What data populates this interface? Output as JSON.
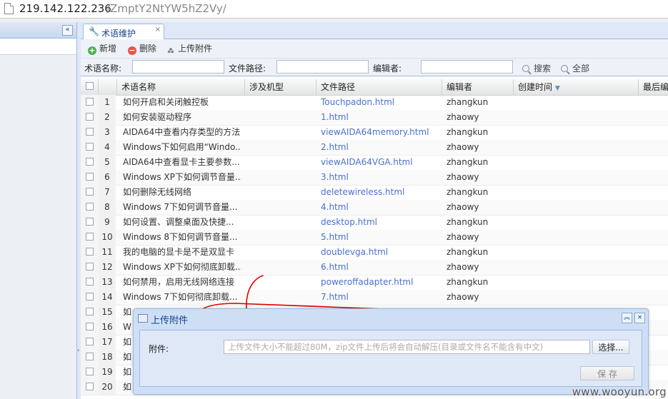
{
  "browser": {
    "host": "219.142.122.236",
    "path": "/ZmptY2NtYW5hZ2Vy/"
  },
  "sidebar": {
    "collapse_glyph": "«"
  },
  "tab": {
    "label": "术语维护",
    "icon": "wrench-icon",
    "close_glyph": "×"
  },
  "toolbar": {
    "add": "新增",
    "delete": "删除",
    "upload": "上传附件"
  },
  "filter": {
    "term_label": "术语名称:",
    "path_label": "文件路径:",
    "editor_label": "编辑者:",
    "search": "搜索",
    "all": "全部"
  },
  "grid": {
    "columns": [
      "术语名称",
      "涉及机型",
      "文件路径",
      "编辑者",
      "创建时间",
      "最后编"
    ],
    "sort_column": "创建时间",
    "rows": [
      {
        "num": "1",
        "name": "如何开启和关闭触控板",
        "path": "Touchpadon.html",
        "editor": "zhangkun"
      },
      {
        "num": "2",
        "name": "如何安装驱动程序",
        "path": "1.html",
        "editor": "zhaowy"
      },
      {
        "num": "3",
        "name": "AIDA64中查看内存类型的方法",
        "path": "viewAIDA64memory.html",
        "editor": "zhangkun"
      },
      {
        "num": "4",
        "name": "Windows下如何启用“Windo...",
        "path": "2.html",
        "editor": "zhaowy"
      },
      {
        "num": "5",
        "name": "AIDA64中查看显卡主要参数...",
        "path": "viewAIDA64VGA.html",
        "editor": "zhangkun"
      },
      {
        "num": "6",
        "name": "Windows XP下如何调节音量...",
        "path": "3.html",
        "editor": "zhaowy"
      },
      {
        "num": "7",
        "name": "如何删除无线网络",
        "path": "deletewireless.html",
        "editor": "zhangkun"
      },
      {
        "num": "8",
        "name": "Windows 7下如何调节音量...",
        "path": "4.html",
        "editor": "zhaowy"
      },
      {
        "num": "9",
        "name": "如何设置、调整桌面及快捷...",
        "path": "desktop.html",
        "editor": "zhangkun"
      },
      {
        "num": "10",
        "name": "Windows 8下如何调节音量...",
        "path": "5.html",
        "editor": "zhaowy"
      },
      {
        "num": "11",
        "name": "我的电脑的显卡是不是双显卡",
        "path": "doublevga.html",
        "editor": "zhangkun"
      },
      {
        "num": "12",
        "name": "Windows XP下如何彻底卸载...",
        "path": "6.html",
        "editor": "zhaowy"
      },
      {
        "num": "13",
        "name": "如何禁用，启用无线网络连接",
        "path": "poweroffadapter.html",
        "editor": "zhangkun"
      },
      {
        "num": "14",
        "name": "Windows 7下如何彻底卸载...",
        "path": "7.html",
        "editor": "zhaowy"
      },
      {
        "num": "15",
        "name": "如",
        "path": "",
        "editor": ""
      },
      {
        "num": "16",
        "name": "W",
        "path": "",
        "editor": ""
      },
      {
        "num": "17",
        "name": "如",
        "path": "",
        "editor": ""
      },
      {
        "num": "18",
        "name": "如",
        "path": "",
        "editor": ""
      },
      {
        "num": "19",
        "name": "如",
        "path": "",
        "editor": ""
      },
      {
        "num": "20",
        "name": "如",
        "path": "",
        "editor": ""
      }
    ]
  },
  "dialog": {
    "title": "上传附件",
    "field_label": "附件:",
    "placeholder": "上传文件大小不能超过80M，zip文件上传后将会自动解压(目录或文件名不能含有中文)",
    "browse": "选择...",
    "save": "保 存",
    "collapse_glyph": "︽",
    "close_glyph": "×"
  },
  "watermark": "www.wooyun.org",
  "colors": {
    "link": "#4a6fd0",
    "accent": "#15428b",
    "panel": "#dfe8f6",
    "scribble": "#e00000"
  }
}
